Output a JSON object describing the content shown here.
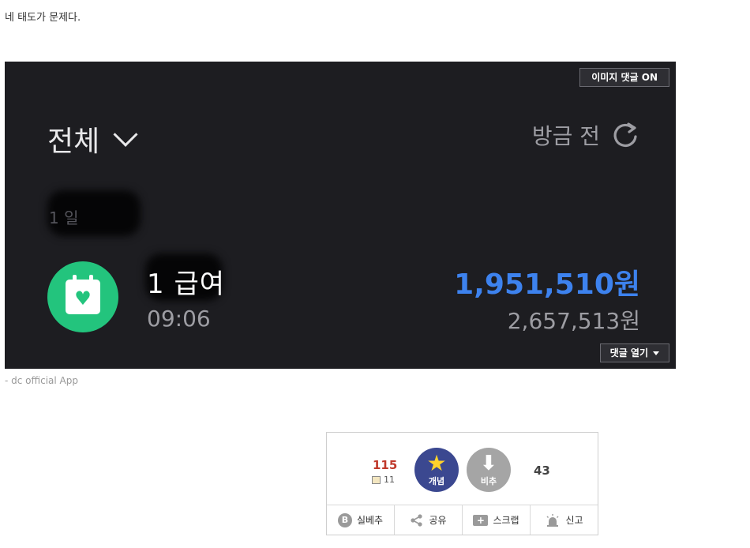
{
  "post": {
    "text": "네 태도가 문제다."
  },
  "image": {
    "image_comment_button": "이미지 댓글 ON",
    "filter_label": "전체",
    "refresh_label": "방금 전",
    "blurred_date_partial": "1 일",
    "item_name": "1 급여",
    "item_time": "09:06",
    "amount_main": "1,951,510원",
    "amount_sub": "2,657,513원",
    "comment_open_button": "댓글 열기",
    "calendar_icon": "calendar-heart-icon",
    "accent_color": "#3d82ee",
    "icon_bg_color": "#23c47d"
  },
  "source": {
    "text": "- dc official App"
  },
  "vote": {
    "up_count": "115",
    "fixed_count": "11",
    "up_label": "개념",
    "down_label": "비추",
    "down_count": "43",
    "actions": [
      "실베추",
      "공유",
      "스크랩",
      "신고"
    ]
  }
}
